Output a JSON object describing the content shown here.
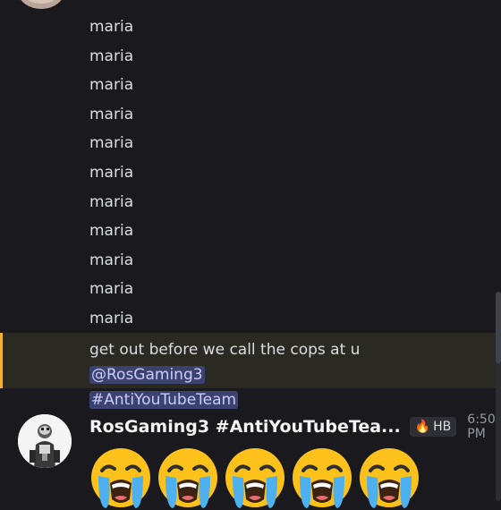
{
  "messages": [
    {
      "text": "maria"
    },
    {
      "text": "maria"
    },
    {
      "text": "maria"
    },
    {
      "text": "maria"
    },
    {
      "text": "maria"
    },
    {
      "text": "maria"
    },
    {
      "text": "maria"
    },
    {
      "text": "maria"
    },
    {
      "text": "maria"
    },
    {
      "text": "maria"
    },
    {
      "text": "maria"
    }
  ],
  "mention_message": {
    "text_before": "get out before we call the cops at u ",
    "mention_user": "@RosGaming3",
    "mention_role": "#AntiYouTubeTeam"
  },
  "post": {
    "username": "RosGaming3 #AntiYouTubeTea...",
    "tag_label": "HB",
    "tag_icon": "flame-icon",
    "timestamp": "6:50 PM",
    "emoji_name": "loudly-crying-face-icon",
    "emoji_count": 5
  },
  "colors": {
    "background": "#1a1a1e",
    "mention_highlight": "#2b2a22",
    "mention_bar": "#f0b232",
    "mention_chip": "#3c4270"
  }
}
